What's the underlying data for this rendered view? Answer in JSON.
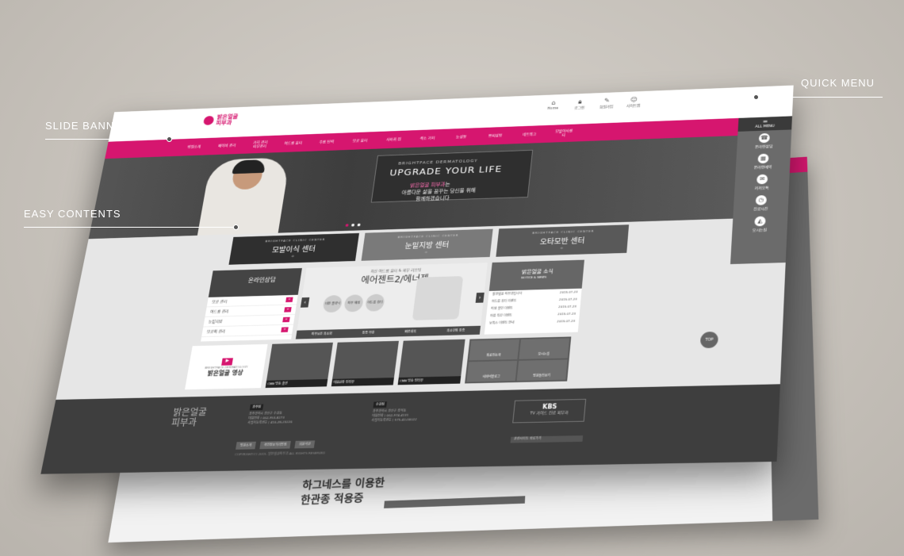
{
  "callouts": {
    "quick_menu": "QUICK MENU",
    "slide_banner": "SLIDE BANNER",
    "easy_contents": "EASY CONTENTS"
  },
  "logo": {
    "line1": "밝은얼굴",
    "line2": "피부과"
  },
  "top_icons": [
    "Home",
    "로그인",
    "회원가입",
    "사이트맵"
  ],
  "gnb": [
    "병원소개",
    "베이비 관리",
    "가히 관리 피부관리",
    "여드름 흉터",
    "주름 탄력",
    "모공 흉터",
    "사마귀 점",
    "색소 기미",
    "눈성형",
    "쁘띠성형",
    "네트워크",
    "모발이식센터"
  ],
  "banner": {
    "sub": "BRIGHTFACE DERMATOLOGY",
    "title": "UPGRADE YOUR LIFE",
    "line1_brand": "밝은얼굴 피부과",
    "line1_rest": "는",
    "line2": "아름다운 삶을 꿈꾸는 당신을 위해",
    "line3": "함께하겠습니다"
  },
  "quick": {
    "head": "ALL MENU",
    "items": [
      "온라인상담",
      "온라인예약",
      "카카오톡",
      "진료시간",
      "오시는길"
    ]
  },
  "centers": [
    {
      "en": "BRIGHTFACE CLINIC CENTER",
      "kr": "모발이식 센터"
    },
    {
      "en": "BRIGHTFACE CLINIC CENTER",
      "kr": "눈밑지방 센터"
    },
    {
      "en": "BRIGHTFACE CLINIC CENTER",
      "kr": "오타모반 센터"
    }
  ],
  "left_panel": {
    "title": "온라인상담",
    "rows": [
      "모공 관리",
      "여드름 관리",
      "눈밑지방",
      "모공의 관리"
    ]
  },
  "center_panel": {
    "sub": "최신 여드름 흉터 & 피부 리프팅",
    "title": "에어젠트2/에너젯",
    "circles": [
      "비만 클리닉",
      "피부 재생",
      "여드름 흉터"
    ],
    "bar": [
      "피부보존 최소화",
      "통증 무감",
      "빠른회복",
      "최소한의 통증"
    ]
  },
  "right_panel": {
    "title": "밝은얼굴 소식",
    "sub": "NOTICE & NEWS",
    "rows": [
      {
        "t": "밝은얼굴 피부과입니다",
        "d": "2015.07.23"
      },
      {
        "t": "여드름 흉터 이벤트",
        "d": "2015.07.23"
      },
      {
        "t": "미생 할인 이벤트",
        "d": "2015.07.23"
      },
      {
        "t": "여름 특강 이벤트",
        "d": "2015.07.23"
      },
      {
        "t": "보톡스 이벤트 안내",
        "d": "2015.07.23"
      }
    ]
  },
  "video": {
    "en": "BRIGHTFACE DERMATOLOGY",
    "kr": "밝은얼굴 영상"
  },
  "thumbs": [
    "CMB 방송 출연",
    "대표원장 인터뷰",
    "CMB 방송 인터뷰"
  ],
  "grid": [
    "의료진소개",
    "오시는길",
    "네이버블로그",
    "병원둘러보기"
  ],
  "top_label": "TOP",
  "footer": {
    "logo1": "밝은얼굴",
    "logo2": "피부과",
    "col1_title": "광주점",
    "col1_lines": [
      "광주광역시 광산구 수완동",
      "대표전화 | 062-953-8273",
      "사업자등록번호 | 410-28-23226"
    ],
    "col2_title": "수완점",
    "col2_lines": [
      "광주광역시 광산구 장덕동",
      "대표전화 | 062-974-4131",
      "사업자등록번호 | 575-42-00022"
    ],
    "kbs": "KBS",
    "kbs_sub": "TV 가이드 진료 피부과",
    "btns": [
      "병원소개",
      "개인정보처리방침",
      "회원약관"
    ],
    "copy": "COPYRIGHT(C) 2015. 밝은얼굴피부과 ALL RIGHTS RESERVED",
    "family": "관련사이트 바로가기"
  },
  "back": {
    "text1": "하그네스를 이용한",
    "text2": "한관종 적용증"
  }
}
